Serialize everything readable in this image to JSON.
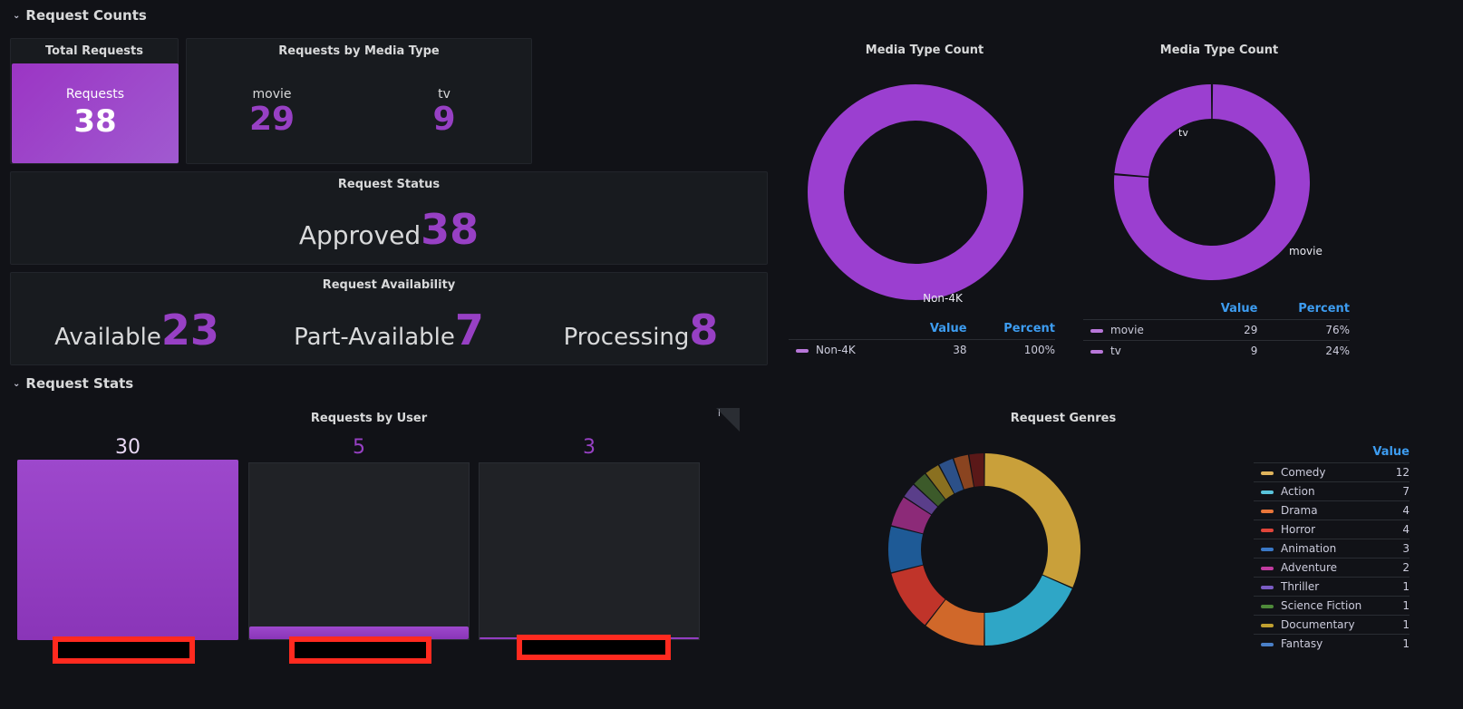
{
  "sections": {
    "counts_title": "Request Counts",
    "stats_title": "Request Stats"
  },
  "total_requests": {
    "title": "Total Requests",
    "label": "Requests",
    "value": "38"
  },
  "media_type": {
    "title": "Requests by Media Type",
    "items": [
      {
        "label": "movie",
        "value": "29"
      },
      {
        "label": "tv",
        "value": "9"
      }
    ]
  },
  "request_status": {
    "title": "Request Status",
    "label": "Approved",
    "value": "38"
  },
  "request_availability": {
    "title": "Request Availability",
    "items": [
      {
        "label": "Available",
        "value": "23"
      },
      {
        "label": "Part-Available",
        "value": "7"
      },
      {
        "label": "Processing",
        "value": "8"
      }
    ]
  },
  "media_count_1": {
    "title": "Media Type Count",
    "slice_label": "Non-4K",
    "legend_value": "Value",
    "legend_percent": "Percent",
    "rows": [
      {
        "name": "Non-4K",
        "value": "38",
        "percent": "100%",
        "color": "#b877d9"
      }
    ]
  },
  "media_count_2": {
    "title": "Media Type Count",
    "slice_labels": [
      "tv",
      "movie"
    ],
    "legend_value": "Value",
    "legend_percent": "Percent",
    "rows": [
      {
        "name": "movie",
        "value": "29",
        "percent": "76%",
        "color": "#b877d9"
      },
      {
        "name": "tv",
        "value": "9",
        "percent": "24%",
        "color": "#b877d9"
      }
    ]
  },
  "requests_by_user": {
    "title": "Requests by User",
    "info_icon": "i",
    "values": [
      "30",
      "5",
      "3"
    ]
  },
  "request_genres": {
    "title": "Request Genres",
    "legend_value": "Value",
    "rows": [
      {
        "name": "Comedy",
        "value": "12",
        "color": "#e0b45c"
      },
      {
        "name": "Action",
        "value": "7",
        "color": "#5ac4db"
      },
      {
        "name": "Drama",
        "value": "4",
        "color": "#e8763a"
      },
      {
        "name": "Horror",
        "value": "4",
        "color": "#e0453a"
      },
      {
        "name": "Animation",
        "value": "3",
        "color": "#3a78c6"
      },
      {
        "name": "Adventure",
        "value": "2",
        "color": "#c13ba0"
      },
      {
        "name": "Thriller",
        "value": "1",
        "color": "#7a5cc4"
      },
      {
        "name": "Science Fiction",
        "value": "1",
        "color": "#4e8a3a"
      },
      {
        "name": "Documentary",
        "value": "1",
        "color": "#c0a030"
      },
      {
        "name": "Fantasy",
        "value": "1",
        "color": "#4a80c8"
      }
    ]
  },
  "chart_data": [
    {
      "type": "pie",
      "title": "Media Type Count",
      "categories": [
        "Non-4K"
      ],
      "values": [
        38
      ]
    },
    {
      "type": "pie",
      "title": "Media Type Count",
      "categories": [
        "movie",
        "tv"
      ],
      "values": [
        29,
        9
      ]
    },
    {
      "type": "bar",
      "title": "Requests by User",
      "categories": [
        "",
        "",
        ""
      ],
      "values": [
        30,
        5,
        3
      ]
    },
    {
      "type": "pie",
      "title": "Request Genres",
      "categories": [
        "Comedy",
        "Action",
        "Drama",
        "Horror",
        "Animation",
        "Adventure",
        "Thriller",
        "Science Fiction",
        "Documentary",
        "Fantasy",
        "",
        ""
      ],
      "values": [
        12,
        7,
        4,
        4,
        3,
        2,
        1,
        1,
        1,
        1,
        1,
        1
      ]
    }
  ]
}
